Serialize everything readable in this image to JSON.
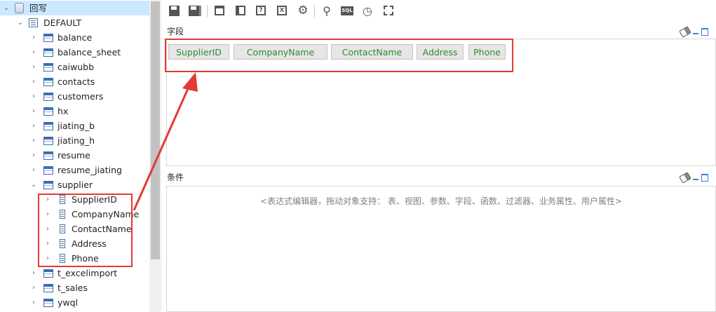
{
  "tree": {
    "root_label": "回写",
    "schema_label": "DEFAULT",
    "tables": [
      "balance",
      "balance_sheet",
      "caiwubb",
      "contacts",
      "customers",
      "hx",
      "jiating_b",
      "jiating_h",
      "resume",
      "resume_jiating",
      "supplier"
    ],
    "supplier_fields": [
      "SupplierID",
      "CompanyName",
      "ContactName",
      "Address",
      "Phone"
    ],
    "tables_after": [
      "t_excelimport",
      "t_sales",
      "ywql"
    ]
  },
  "toolbar": {
    "icons": [
      "save-icon",
      "save-as-icon",
      "layout-icon",
      "table-properties-icon",
      "help-icon",
      "export-excel-icon",
      "settings-icon",
      "search-icon",
      "sql-icon",
      "clock-icon",
      "select-area-icon"
    ],
    "sql_text": "SQL"
  },
  "fields_panel": {
    "title": "字段",
    "chips": [
      "SupplierID",
      "CompanyName",
      "ContactName",
      "Address",
      "Phone"
    ]
  },
  "condition_panel": {
    "title": "条件",
    "placeholder": "<表达式编辑器，拖动对象支持：  表、视图、参数、字段、函数、过滤器、业务属性、用户属性>"
  },
  "colors": {
    "highlight": "#e53935",
    "chip_text": "#2e8b2e",
    "selected_row": "#cce8ff"
  }
}
